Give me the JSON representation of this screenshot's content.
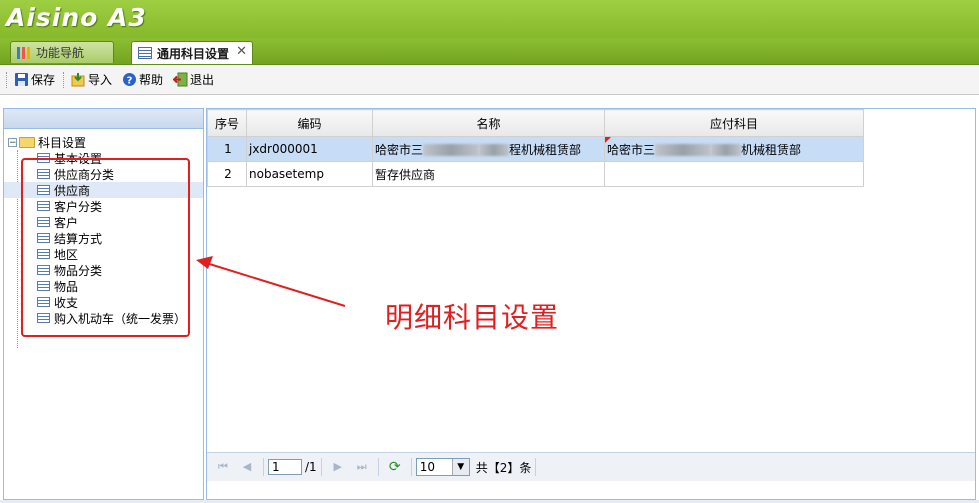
{
  "app": {
    "logo_text": "Aisino A3"
  },
  "tabs": [
    {
      "label": "功能导航",
      "icon": "chart-icon",
      "active": false
    },
    {
      "label": "通用科目设置",
      "icon": "list-icon",
      "active": true,
      "close": "✕"
    }
  ],
  "toolbar": {
    "save_label": "保存",
    "import_label": "导入",
    "help_label": "帮助",
    "exit_label": "退出"
  },
  "tree": {
    "root_label": "科目设置",
    "items": [
      {
        "label": "基本设置"
      },
      {
        "label": "供应商分类"
      },
      {
        "label": "供应商",
        "selected": true
      },
      {
        "label": "客户分类"
      },
      {
        "label": "客户"
      },
      {
        "label": "结算方式"
      },
      {
        "label": "地区"
      },
      {
        "label": "物品分类"
      },
      {
        "label": "物品"
      },
      {
        "label": "收支"
      },
      {
        "label": "购入机动车（统一发票）"
      }
    ]
  },
  "grid": {
    "columns": [
      "序号",
      "编码",
      "名称",
      "应付科目"
    ],
    "rows": [
      {
        "index": "1",
        "code": "jxdr000001",
        "name_prefix": "哈密市三",
        "name_suffix": "程机械租赁部",
        "account_prefix": "哈密市三",
        "account_suffix": "机械租赁部",
        "selected": true
      },
      {
        "index": "2",
        "code": "nobasetemp",
        "name_prefix": "暂存供应商",
        "name_suffix": "",
        "account_prefix": "",
        "account_suffix": "",
        "selected": false
      }
    ]
  },
  "pager": {
    "current_page": "1",
    "total_pages": "/1",
    "page_size": "10",
    "total_text": "共【2】条"
  },
  "annotation": {
    "text": "明细科目设置",
    "color": "#e02020"
  },
  "colors": {
    "header_green": "#86b92b",
    "selection_blue": "#c7dcf5",
    "panel_border": "#99bbe8"
  }
}
